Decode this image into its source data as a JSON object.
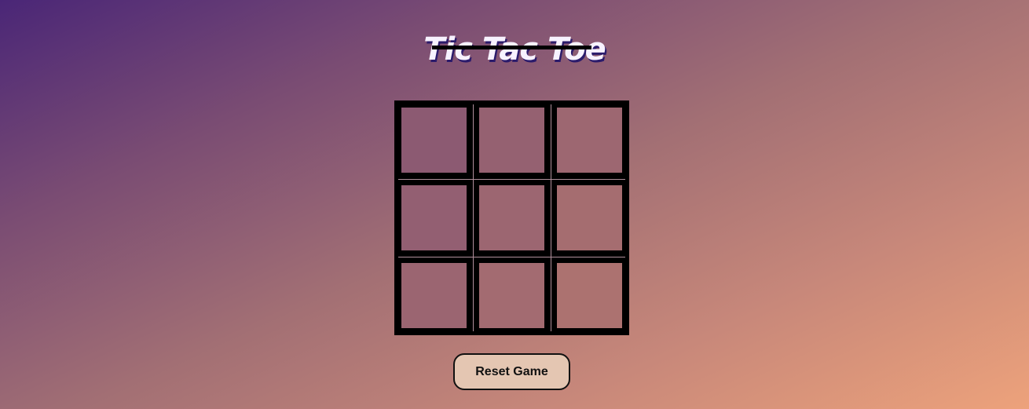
{
  "title": "Tic Tac Toe",
  "board": {
    "cells": [
      "",
      "",
      "",
      "",
      "",
      "",
      "",
      "",
      ""
    ]
  },
  "reset_button": {
    "label": "Reset Game"
  },
  "colors": {
    "gradient_start": "#4a2677",
    "gradient_end": "#eda27b",
    "board_background": "#000000",
    "button_background": "#e4c6b2"
  }
}
